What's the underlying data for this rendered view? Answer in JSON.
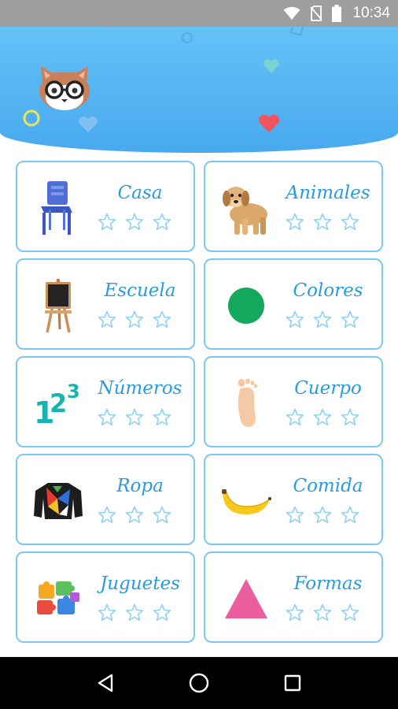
{
  "status_bar": {
    "time": "10:34",
    "icons": [
      "wifi-icon",
      "no-sim-icon",
      "battery-icon"
    ]
  },
  "header": {
    "mascot": "cat-with-glasses-icon",
    "colors": {
      "top": "#64c2f6",
      "bottom": "#48a9ef"
    }
  },
  "categories": [
    {
      "label": "Casa",
      "icon": "chair-icon",
      "stars": 3
    },
    {
      "label": "Animales",
      "icon": "puppy-icon",
      "stars": 3
    },
    {
      "label": "Escuela",
      "icon": "chalkboard-easel-icon",
      "stars": 3
    },
    {
      "label": "Colores",
      "icon": "green-circle-icon",
      "stars": 3
    },
    {
      "label": "Números",
      "icon": "numbers-123-icon",
      "stars": 3
    },
    {
      "label": "Cuerpo",
      "icon": "foot-icon",
      "stars": 3
    },
    {
      "label": "Ropa",
      "icon": "sweater-icon",
      "stars": 3
    },
    {
      "label": "Comida",
      "icon": "banana-icon",
      "stars": 3
    },
    {
      "label": "Juguetes",
      "icon": "puzzle-pieces-icon",
      "stars": 3
    },
    {
      "label": "Formas",
      "icon": "pink-triangle-icon",
      "stars": 3
    }
  ],
  "card_colors": {
    "border": "#7cc8f4",
    "title": "#2a9bde",
    "star_outline": "#8fd0f5"
  },
  "nav_bar": {
    "buttons": [
      "back-icon",
      "home-icon",
      "recents-icon"
    ]
  }
}
